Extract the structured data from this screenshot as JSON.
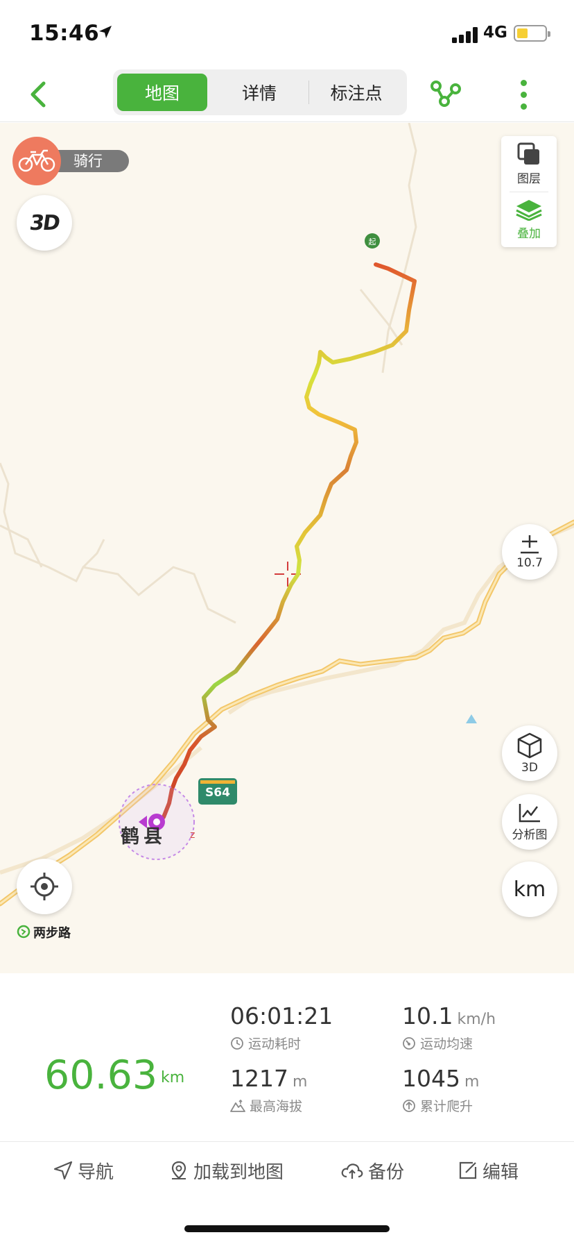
{
  "status_bar": {
    "time": "15:46",
    "network": "4G"
  },
  "nav": {
    "tabs": [
      "地图",
      "详情",
      "标注点"
    ],
    "active_tab": "地图"
  },
  "map": {
    "mode_label": "骑行",
    "layer_label": "图层",
    "overlay_label": "叠加",
    "zoom_level": "10.7",
    "three_d_label": "3D",
    "analysis_label": "分析图",
    "unit_button": "km",
    "road_shield": "S64",
    "town_label": "鹤县",
    "start_marker": "起",
    "brand": "两步路",
    "accent_color": "#49b33d"
  },
  "stats": {
    "total_distance": "60.63",
    "total_distance_unit": "km",
    "duration": {
      "value": "06:01:21",
      "label": "运动耗时"
    },
    "avg_speed": {
      "value": "10.1",
      "unit": "km/h",
      "label": "运动均速"
    },
    "max_altitude": {
      "value": "1217",
      "unit": "m",
      "label": "最高海拔"
    },
    "total_climb": {
      "value": "1045",
      "unit": "m",
      "label": "累计爬升"
    }
  },
  "toolbar": {
    "navigate": "导航",
    "load_to_map": "加载到地图",
    "backup": "备份",
    "edit": "编辑"
  }
}
